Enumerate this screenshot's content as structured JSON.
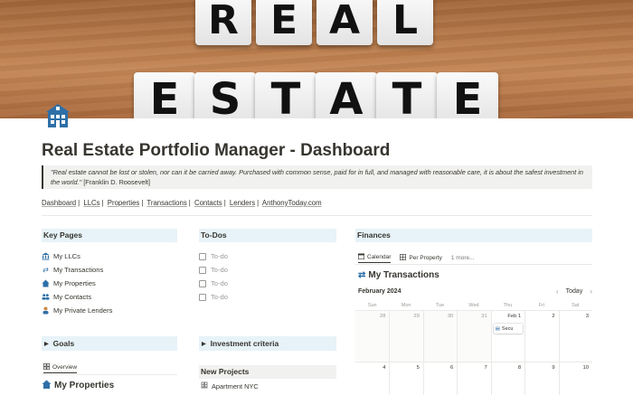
{
  "banner": {
    "row1": [
      "R",
      "E",
      "A",
      "L"
    ],
    "row2": [
      "E",
      "S",
      "T",
      "A",
      "T",
      "E"
    ]
  },
  "page": {
    "icon": "house-icon",
    "title": "Real Estate Portfolio Manager - Dashboard",
    "quote": "\"Real estate cannot be lost or stolen, nor can it be carried away. Purchased with common sense, paid for in full, and managed with reasonable care, it is about the safest investment in the world.\"",
    "quote_author": "[Franklin D. Roosevelt]"
  },
  "nav_links": [
    "Dashboard",
    "LLCs",
    "Properties",
    "Transactions",
    "Contacts",
    "Lenders",
    "AnthonyToday.com"
  ],
  "key_pages": {
    "heading": "Key Pages",
    "items": [
      {
        "label": "My LLCs",
        "icon": "bank-icon"
      },
      {
        "label": "My Transactions",
        "icon": "arrows-icon"
      },
      {
        "label": "My Properties",
        "icon": "home-icon"
      },
      {
        "label": "My Contacts",
        "icon": "people-icon"
      },
      {
        "label": "My Private Lenders",
        "icon": "person-icon"
      }
    ]
  },
  "todos": {
    "heading": "To-Dos",
    "items": [
      "To-do",
      "To-do",
      "To-do",
      "To-do"
    ]
  },
  "finances": {
    "heading": "Finances",
    "tabs": [
      {
        "label": "Calendar",
        "icon": "calendar-icon"
      },
      {
        "label": "Per Property",
        "icon": "table-icon"
      },
      {
        "label": "1 more...",
        "icon": ""
      }
    ],
    "transactions_heading": "My Transactions",
    "month": "February 2024",
    "today_label": "Today",
    "weekdays": [
      "Sun",
      "Mon",
      "Tue",
      "Wed",
      "Thu",
      "Fri",
      "Sat"
    ],
    "weeks": [
      [
        "28",
        "29",
        "30",
        "31",
        "Feb 1",
        "2",
        "3"
      ],
      [
        "4",
        "5",
        "6",
        "7",
        "8",
        "9",
        "10"
      ]
    ],
    "event": "Secu"
  },
  "goals": {
    "label": "Goals"
  },
  "investment": {
    "label": "Investment criteria"
  },
  "overview_tab": "Overview",
  "properties_heading": "My Properties",
  "new_projects": {
    "heading": "New Projects",
    "items": [
      "Apartment NYC"
    ]
  }
}
